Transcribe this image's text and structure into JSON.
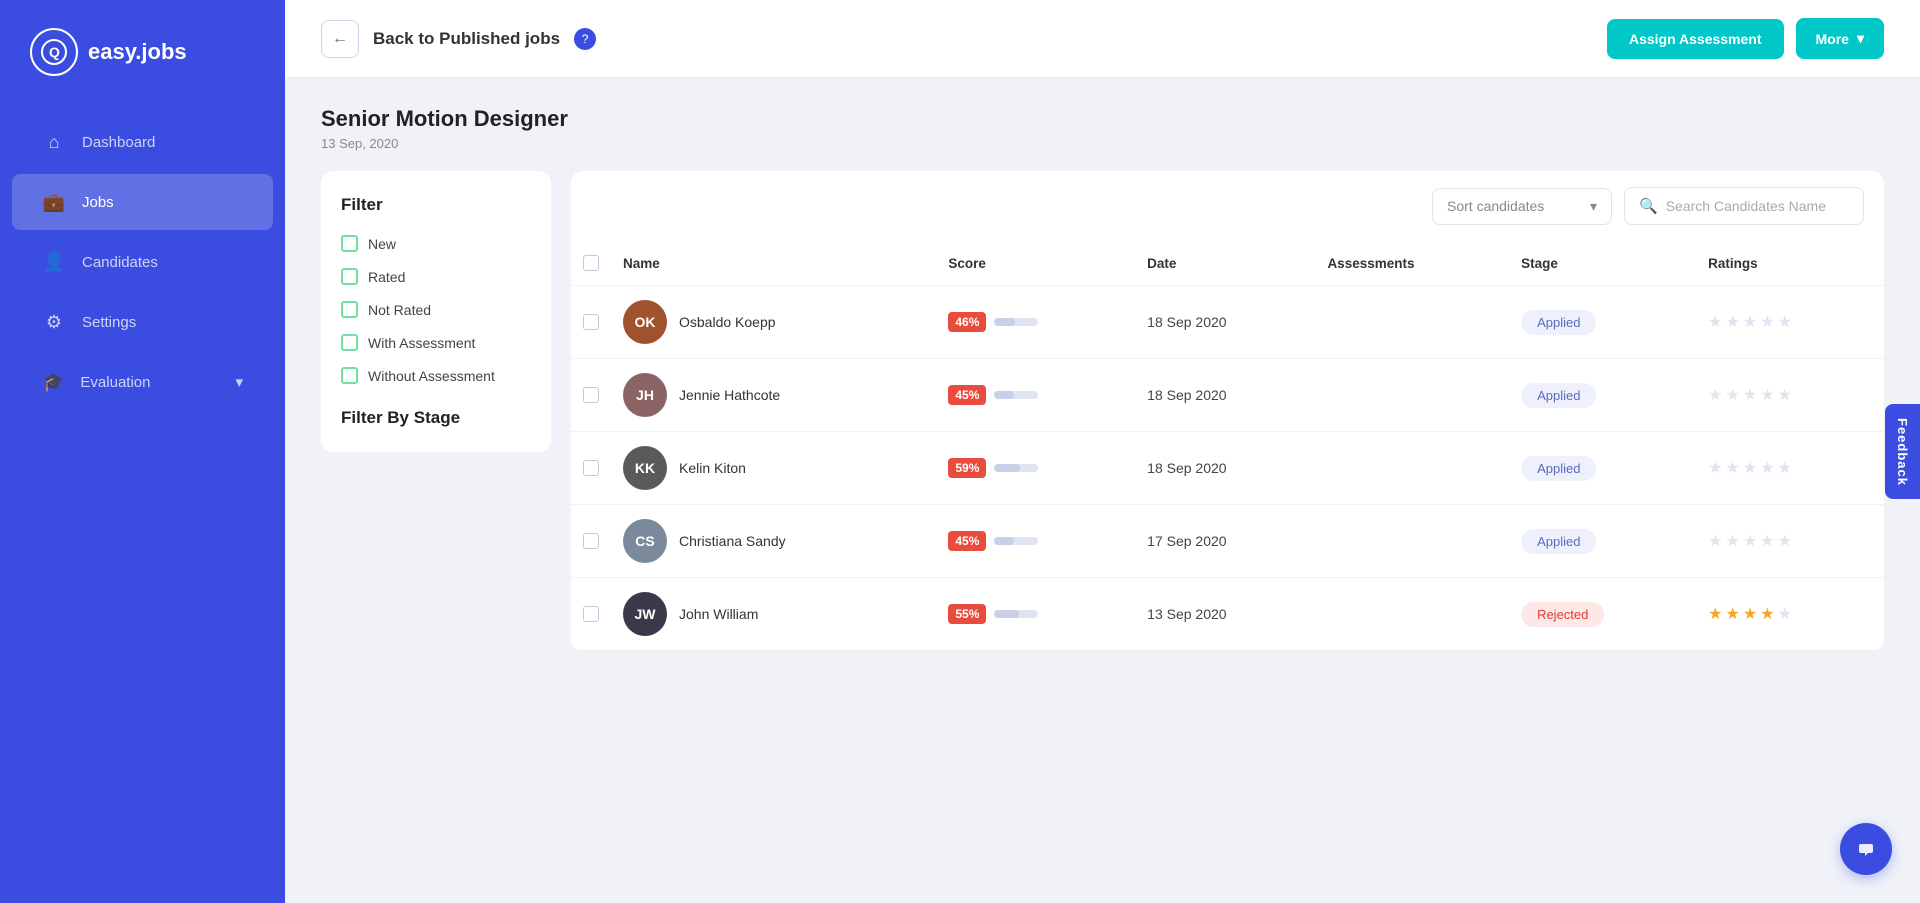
{
  "sidebar": {
    "logo": {
      "icon": "Q",
      "text": "easy.jobs"
    },
    "items": [
      {
        "id": "dashboard",
        "label": "Dashboard",
        "icon": "⌂",
        "active": false
      },
      {
        "id": "jobs",
        "label": "Jobs",
        "icon": "💼",
        "active": true
      },
      {
        "id": "candidates",
        "label": "Candidates",
        "icon": "👤",
        "active": false
      },
      {
        "id": "settings",
        "label": "Settings",
        "icon": "⚙",
        "active": false
      },
      {
        "id": "evaluation",
        "label": "Evaluation",
        "icon": "🎓",
        "active": false
      }
    ]
  },
  "header": {
    "back_label": "Back to Published jobs",
    "assign_button": "Assign Assessment",
    "more_button": "More",
    "chevron": "▾"
  },
  "job": {
    "title": "Senior Motion Designer",
    "date": "13 Sep, 2020"
  },
  "filter": {
    "title": "Filter",
    "items": [
      {
        "id": "new",
        "label": "New"
      },
      {
        "id": "rated",
        "label": "Rated"
      },
      {
        "id": "not-rated",
        "label": "Not Rated"
      },
      {
        "id": "with-assessment",
        "label": "With Assessment"
      },
      {
        "id": "without-assessment",
        "label": "Without Assessment"
      }
    ],
    "filter_by_stage": "Filter By Stage"
  },
  "table": {
    "sort_placeholder": "Sort candidates",
    "search_placeholder": "Search Candidates Name",
    "columns": [
      "Name",
      "Score",
      "Date",
      "Assessments",
      "Stage",
      "Ratings"
    ],
    "candidates": [
      {
        "id": 1,
        "name": "Osbaldo Koepp",
        "score": "46%",
        "score_pct": 46,
        "date": "18 Sep 2020",
        "assessments": "",
        "stage": "Applied",
        "stage_type": "applied",
        "stars": 0,
        "avatar_color": "#a0522d",
        "avatar_initials": "OK"
      },
      {
        "id": 2,
        "name": "Jennie Hathcote",
        "score": "45%",
        "score_pct": 45,
        "date": "18 Sep 2020",
        "assessments": "",
        "stage": "Applied",
        "stage_type": "applied",
        "stars": 0,
        "avatar_color": "#8b6565",
        "avatar_initials": "JH"
      },
      {
        "id": 3,
        "name": "Kelin Kiton",
        "score": "59%",
        "score_pct": 59,
        "date": "18 Sep 2020",
        "assessments": "",
        "stage": "Applied",
        "stage_type": "applied",
        "stars": 0,
        "avatar_color": "#5a5a5a",
        "avatar_initials": "KK"
      },
      {
        "id": 4,
        "name": "Christiana Sandy",
        "score": "45%",
        "score_pct": 45,
        "date": "17 Sep 2020",
        "assessments": "",
        "stage": "Applied",
        "stage_type": "applied",
        "stars": 0,
        "avatar_color": "#7a8a9a",
        "avatar_initials": "CS"
      },
      {
        "id": 5,
        "name": "John William",
        "score": "55%",
        "score_pct": 55,
        "date": "13 Sep 2020",
        "assessments": "",
        "stage": "Rejected",
        "stage_type": "rejected",
        "stars": 4,
        "avatar_color": "#3a3a4a",
        "avatar_initials": "JW"
      }
    ]
  },
  "feedback_tab": "Feedback",
  "chat_icon": "💬"
}
